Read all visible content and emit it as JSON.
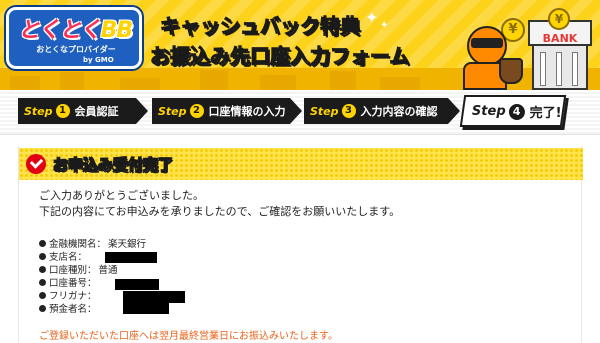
{
  "header": {
    "logo_text_a": "とくとく",
    "logo_text_b": "BB",
    "logo_tagline": "おとくなプロバイダー",
    "logo_company": "by GMO",
    "title_line1": "キャッシュバック特典",
    "title_line2": "お振込み先口座入力フォーム",
    "bank_label": "BANK",
    "coin_symbol": "¥"
  },
  "steps": [
    {
      "prefix": "Step",
      "num": "1",
      "label": "会員認証"
    },
    {
      "prefix": "Step",
      "num": "2",
      "label": "口座情報の入力"
    },
    {
      "prefix": "Step",
      "num": "3",
      "label": "入力内容の確認"
    },
    {
      "prefix": "Step",
      "num": "4",
      "label": "完了!"
    }
  ],
  "section": {
    "title": "お申込み受付完了"
  },
  "message": {
    "line1": "ご入力ありがとうございました。",
    "line2": "下記の内容にてお申込みを承りましたので、ご確認をお願いいたします。"
  },
  "details": [
    {
      "key": "金融機関名：",
      "value": "楽天銀行"
    },
    {
      "key": "支店名：",
      "value": ""
    },
    {
      "key": "口座種別：",
      "value": "普通"
    },
    {
      "key": "口座番号：",
      "value": ""
    },
    {
      "key": "フリガナ：",
      "value": ""
    },
    {
      "key": "預金者名：",
      "value": ""
    }
  ],
  "notice": "ご登録いただいた口座へは翌月最終営業日にお振込みいたします。",
  "colors": {
    "header_bg": "#fdd21b",
    "step_bg": "#1b1b1b",
    "accent_red": "#e30012",
    "notice_orange": "#e8631a"
  }
}
